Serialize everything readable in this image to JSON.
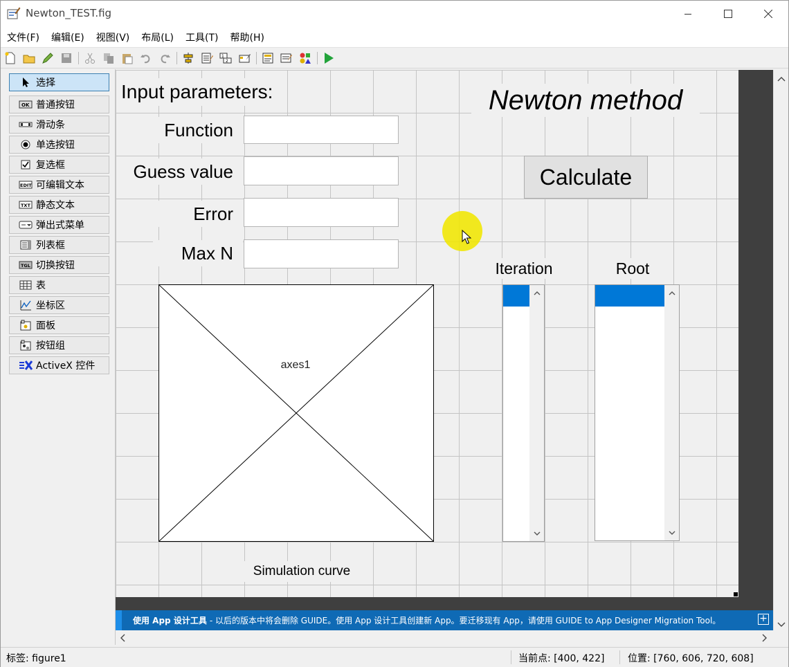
{
  "window": {
    "title": "Newton_TEST.fig"
  },
  "menu": [
    "文件(F)",
    "编辑(E)",
    "视图(V)",
    "布局(L)",
    "工具(T)",
    "帮助(H)"
  ],
  "toolbar_icons": [
    "new-file-icon",
    "open-folder-icon",
    "edit-icon",
    "save-icon",
    "cut-icon",
    "copy-icon",
    "paste-icon",
    "undo-icon",
    "redo-icon",
    "align-icon",
    "menu-editor-icon",
    "tab-order-icon",
    "toolbar-editor-icon",
    "editor-icon",
    "property-inspector-icon",
    "object-browser-icon",
    "run-icon"
  ],
  "palette": [
    {
      "label": "选择",
      "icon": "arrow-pointer-icon",
      "selected": true
    },
    {
      "label": "普通按钮",
      "icon": "push-button-icon"
    },
    {
      "label": "滑动条",
      "icon": "slider-icon"
    },
    {
      "label": "单选按钮",
      "icon": "radio-button-icon"
    },
    {
      "label": "复选框",
      "icon": "checkbox-icon"
    },
    {
      "label": "可编辑文本",
      "icon": "edit-text-icon"
    },
    {
      "label": "静态文本",
      "icon": "static-text-icon"
    },
    {
      "label": "弹出式菜单",
      "icon": "popup-menu-icon"
    },
    {
      "label": "列表框",
      "icon": "listbox-icon"
    },
    {
      "label": "切换按钮",
      "icon": "toggle-button-icon"
    },
    {
      "label": "表",
      "icon": "table-icon"
    },
    {
      "label": "坐标区",
      "icon": "axes-icon"
    },
    {
      "label": "面板",
      "icon": "panel-icon"
    },
    {
      "label": "按钮组",
      "icon": "button-group-icon"
    },
    {
      "label": "ActiveX 控件",
      "icon": "activex-icon"
    }
  ],
  "figure": {
    "input_title": "Input parameters:",
    "method_title": "Newton method",
    "fields": [
      {
        "label": "Function",
        "value": ""
      },
      {
        "label": "Guess value",
        "value": ""
      },
      {
        "label": "Error",
        "value": ""
      },
      {
        "label": "Max N",
        "value": ""
      }
    ],
    "calculate_label": "Calculate",
    "iteration_label": "Iteration",
    "root_label": "Root",
    "axes_label": "axes1",
    "simulation_label": "Simulation curve"
  },
  "infobar": {
    "bold": "使用 App 设计工具",
    "text": "- 以后的版本中将会删除 GUIDE。使用 App 设计工具创建新 App。要迁移现有 App，请使用 GUIDE to App Designer Migration Tool。"
  },
  "status": {
    "tag": "标签: figure1",
    "current_point": "当前点:  [400, 422]",
    "position": "位置: [760, 606, 720, 608]"
  },
  "colors": {
    "selection": "#0078d7",
    "infobar": "#0f6ab5",
    "cursor_highlight": "#f0e600"
  }
}
